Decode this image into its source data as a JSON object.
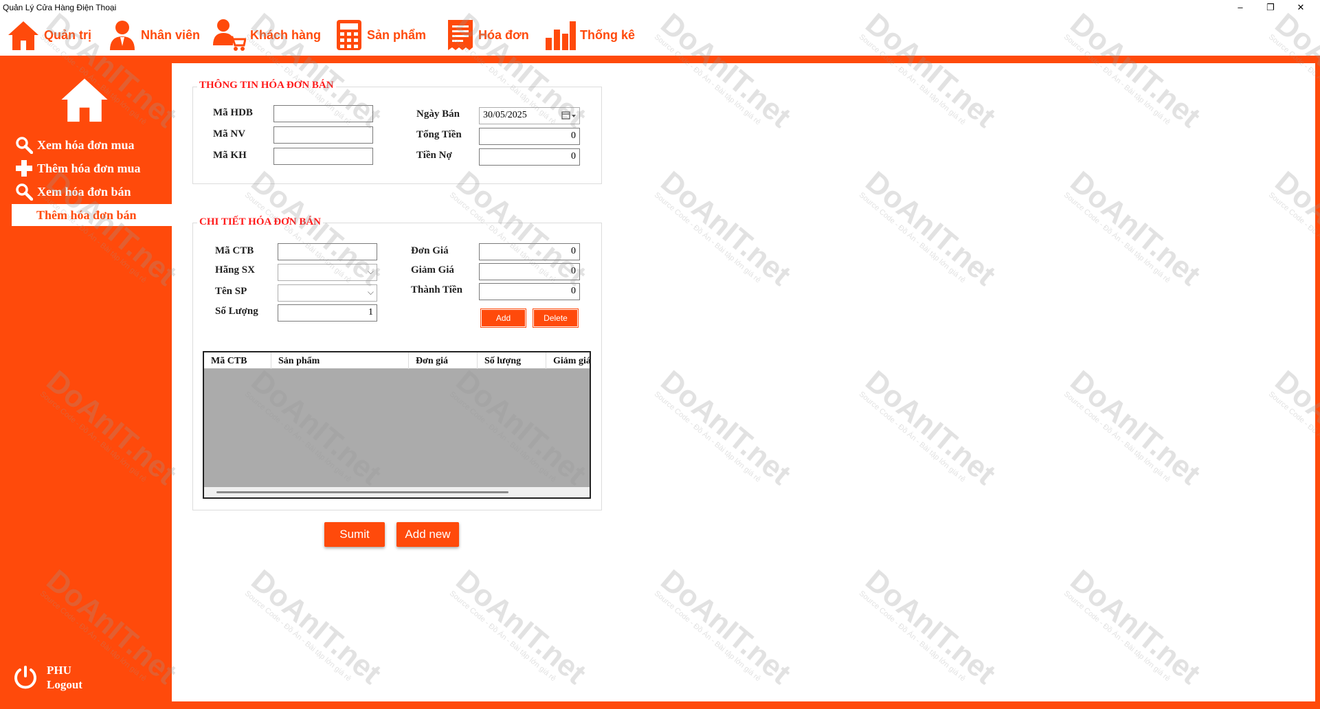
{
  "window": {
    "title": "Quản Lý Cửa Hàng Điện Thoại",
    "controls": [
      "–",
      "❐",
      "✕"
    ]
  },
  "menu": [
    {
      "label": "Quản trị",
      "icon": "home-icon"
    },
    {
      "label": "Nhân viên",
      "icon": "person-icon"
    },
    {
      "label": "Khách hàng",
      "icon": "customer-cart-icon"
    },
    {
      "label": "Sản phẩm",
      "icon": "calculator-icon"
    },
    {
      "label": "Hóa đơn",
      "icon": "invoice-icon"
    },
    {
      "label": "Thống kê",
      "icon": "bar-chart-icon"
    }
  ],
  "sidebar": {
    "logo_icon": "home-icon",
    "items": [
      {
        "label": "Xem hóa đơn mua",
        "icon": "search-icon"
      },
      {
        "label": "Thêm hóa đơn mua",
        "icon": "plus-icon"
      },
      {
        "label": "Xem hóa đơn bán",
        "icon": "search-icon"
      },
      {
        "label": "Thêm hóa đơn bán",
        "icon": "",
        "active": true
      }
    ],
    "user": {
      "name": "PHU",
      "logout_label": "Logout",
      "icon": "power-icon"
    }
  },
  "invoice_info": {
    "title": "THÔNG TIN HÓA ĐƠN BÁN",
    "ma_hdb": {
      "label": "Mã HDB",
      "value": ""
    },
    "ma_nv": {
      "label": "Mã NV",
      "value": ""
    },
    "ma_kh": {
      "label": "Mã KH",
      "value": ""
    },
    "ngay_ban": {
      "label": "Ngày Bán",
      "value": "30/05/2025"
    },
    "tong_tien": {
      "label": "Tổng Tiền",
      "value": "0"
    },
    "tien_no": {
      "label": "Tiền Nợ",
      "value": "0"
    }
  },
  "invoice_detail": {
    "title": "CHI TIẾT HÓA ĐƠN BÁN",
    "ma_ctb": {
      "label": "Mã CTB",
      "value": ""
    },
    "hang_sx": {
      "label": "Hãng SX",
      "value": ""
    },
    "ten_sp": {
      "label": "Tên SP",
      "value": ""
    },
    "so_luong": {
      "label": "Số Lượng",
      "value": "1"
    },
    "don_gia": {
      "label": "Đơn Giá",
      "value": "0"
    },
    "giam_gia": {
      "label": "Giảm Giá",
      "value": "0"
    },
    "thanh_tien": {
      "label": "Thành Tiền",
      "value": "0"
    },
    "add_label": "Add",
    "delete_label": "Delete",
    "grid_columns": [
      "Mã CTB",
      "Sản phẩm",
      "Đơn giá",
      "Số lượng",
      "Giảm giá"
    ]
  },
  "actions": {
    "submit_label": "Sumit",
    "add_new_label": "Add new"
  },
  "watermark": {
    "text": "DoAnIT.net",
    "sub": "Source Code - Đồ Án - Bài tập lớn giá rẻ"
  },
  "colors": {
    "accent": "#ff4a0b",
    "group_title": "#ff1a1a",
    "grid_body": "#ababab"
  }
}
